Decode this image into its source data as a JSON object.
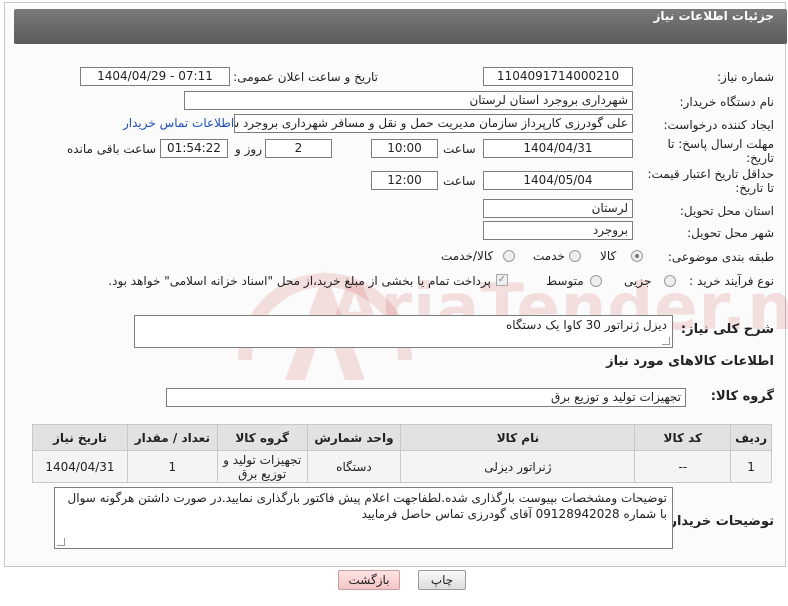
{
  "header": {
    "title": "جزئیات اطلاعات نیاز"
  },
  "fields": {
    "need_number_label": "شماره نیاز:",
    "need_number": "1104091714000210",
    "announce_label": "تاریخ و ساعت اعلان عمومی:",
    "announce_value": "1404/04/29 - 07:11",
    "buyer_org_label": "نام دستگاه خریدار:",
    "buyer_org": "شهرداری بروجرد استان لرستان",
    "creator_label": "ایجاد کننده درخواست:",
    "creator": "علی گودرزی کارپرداز سازمان مدیریت حمل و نقل و مسافر شهرداری بروجرد شهر",
    "contact_link": "اطلاعات تماس خریدار",
    "deadline_label_1": "مهلت ارسال پاسخ: تا",
    "deadline_label_2": "تاریخ:",
    "deadline_date": "1404/04/31",
    "time_label": "ساعت",
    "deadline_time": "10:00",
    "days_value": "2",
    "days_label": "روز و",
    "remaining_time": "01:54:22",
    "remaining_label": "ساعت باقی مانده",
    "validity_label_1": "حداقل تاریخ اعتبار قیمت:",
    "validity_label_2": "تا تاریخ:",
    "validity_date": "1404/05/04",
    "validity_time": "12:00",
    "province_label": "استان محل تحویل:",
    "province": "لرستان",
    "city_label": "شهر محل تحویل:",
    "city": "بروجرد",
    "category_label": "طبقه بندی موضوعی:",
    "category_options": [
      "کالا",
      "خدمت",
      "کالا/خدمت"
    ],
    "category_selected": "کالا",
    "process_label": "نوع فرآیند خرید :",
    "process_options": [
      "جزیی",
      "متوسط"
    ],
    "payment_note": "پرداخت تمام یا بخشی از مبلغ خرید،از محل \"اسناد خزانه اسلامی\" خواهد بود."
  },
  "description": {
    "label": "شرح کلی نیاز:",
    "text": "دیزل ژنراتور 30 کاوا یک دستگاه"
  },
  "goods": {
    "section_title": "اطلاعات کالاهای مورد نیاز",
    "group_label": "گروه کالا:",
    "group_value": "تجهیزات تولید و توزیع برق",
    "columns": [
      "ردیف",
      "کد کالا",
      "نام کالا",
      "واحد شمارش",
      "گروه کالا",
      "تعداد / مقدار",
      "تاریخ نیاز"
    ],
    "rows": [
      [
        "1",
        "--",
        "ژنراتور دیزلی",
        "دستگاه",
        "تجهیزات تولید و توزیع برق",
        "1",
        "1404/04/31"
      ]
    ]
  },
  "buyer_notes": {
    "label": "توضیحات خریدار:",
    "text": "توضیحات ومشخصات بپیوست بارگذاری شده.لطفاجهت اعلام پیش فاکتور بارگذاری نمایید.در صورت داشتن هرگونه سوال با شماره 09128942028 آقای گودرزی تماس حاصل فرمایید"
  },
  "buttons": {
    "print": "چاپ",
    "back": "بازگشت"
  },
  "watermark": "AriaTender.neT",
  "colors": {
    "header_bg": "#656565",
    "link": "#1c4fb8",
    "back_button": "#f3c6c6"
  }
}
